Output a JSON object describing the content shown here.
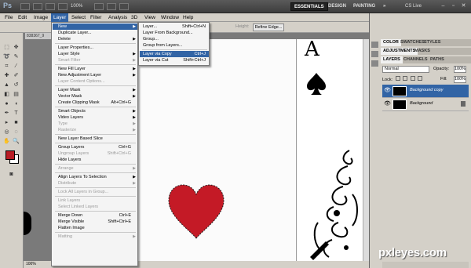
{
  "appbar": {
    "logo": "Ps",
    "zoom": "100%",
    "workspaces": [
      "ESSENTIALS",
      "DESIGN",
      "PAINTING",
      "»"
    ],
    "cs_live": "CS Live",
    "window_controls": [
      "–",
      "▫",
      "✕"
    ]
  },
  "menubar": [
    "File",
    "Edit",
    "Image",
    "Layer",
    "Select",
    "Filter",
    "Analysis",
    "3D",
    "View",
    "Window",
    "Help"
  ],
  "optbar": {
    "height_label": "Height:",
    "refine_edge": "Refine Edge..."
  },
  "doc": {
    "tab": "838367_9",
    "status_zoom": "100%",
    "card_letter": "A"
  },
  "layer_menu": [
    {
      "label": "New",
      "submenu": true,
      "highlight": true
    },
    {
      "label": "Duplicate Layer..."
    },
    {
      "label": "Delete",
      "submenu": true
    },
    {
      "sep": true
    },
    {
      "label": "Layer Properties..."
    },
    {
      "label": "Layer Style",
      "submenu": true
    },
    {
      "label": "Smart Filter",
      "submenu": true,
      "disabled": true
    },
    {
      "sep": true
    },
    {
      "label": "New Fill Layer",
      "submenu": true
    },
    {
      "label": "New Adjustment Layer",
      "submenu": true
    },
    {
      "label": "Layer Content Options...",
      "disabled": true
    },
    {
      "sep": true
    },
    {
      "label": "Layer Mask",
      "submenu": true
    },
    {
      "label": "Vector Mask",
      "submenu": true
    },
    {
      "label": "Create Clipping Mask",
      "shortcut": "Alt+Ctrl+G"
    },
    {
      "sep": true
    },
    {
      "label": "Smart Objects",
      "submenu": true
    },
    {
      "label": "Video Layers",
      "submenu": true
    },
    {
      "label": "Type",
      "submenu": true,
      "disabled": true
    },
    {
      "label": "Rasterize",
      "submenu": true,
      "disabled": true
    },
    {
      "sep": true
    },
    {
      "label": "New Layer Based Slice"
    },
    {
      "sep": true
    },
    {
      "label": "Group Layers",
      "shortcut": "Ctrl+G"
    },
    {
      "label": "Ungroup Layers",
      "shortcut": "Shift+Ctrl+G",
      "disabled": true
    },
    {
      "label": "Hide Layers"
    },
    {
      "sep": true
    },
    {
      "label": "Arrange",
      "submenu": true,
      "disabled": true
    },
    {
      "sep": true
    },
    {
      "label": "Align Layers To Selection",
      "submenu": true
    },
    {
      "label": "Distribute",
      "submenu": true,
      "disabled": true
    },
    {
      "sep": true
    },
    {
      "label": "Lock All Layers in Group...",
      "disabled": true
    },
    {
      "sep": true
    },
    {
      "label": "Link Layers",
      "disabled": true
    },
    {
      "label": "Select Linked Layers",
      "disabled": true
    },
    {
      "sep": true
    },
    {
      "label": "Merge Down",
      "shortcut": "Ctrl+E"
    },
    {
      "label": "Merge Visible",
      "shortcut": "Shift+Ctrl+E"
    },
    {
      "label": "Flatten Image"
    },
    {
      "sep": true
    },
    {
      "label": "Matting",
      "submenu": true,
      "disabled": true
    }
  ],
  "new_submenu": [
    {
      "label": "Layer...",
      "shortcut": "Shift+Ctrl+N"
    },
    {
      "label": "Layer From Background..."
    },
    {
      "label": "Group..."
    },
    {
      "label": "Group from Layers..."
    },
    {
      "sep": true
    },
    {
      "label": "Layer via Copy",
      "shortcut": "Ctrl+J",
      "highlight": true
    },
    {
      "label": "Layer via Cut",
      "shortcut": "Shift+Ctrl+J"
    }
  ],
  "panel": {
    "tabs_row1": [
      "COLOR",
      "SWATCHES",
      "STYLES"
    ],
    "tabs_row2": [
      "ADJUSTMENTS",
      "MASKS"
    ],
    "tabs_row3": [
      "LAYERS",
      "CHANNELS",
      "PATHS"
    ],
    "blend_mode": "Normal",
    "opacity_label": "Opacity:",
    "opacity_value": "100%",
    "lock_label": "Lock:",
    "fill_label": "Fill:",
    "fill_value": "100%",
    "layers": [
      {
        "name": "Background copy",
        "selected": true
      },
      {
        "name": "Background",
        "selected": false
      }
    ]
  },
  "watermark": "pxleyes.com",
  "colors": {
    "foreground": "#b81d25",
    "background": "#ffffff",
    "heart": "#c41a26",
    "accent": "#3264a5"
  }
}
